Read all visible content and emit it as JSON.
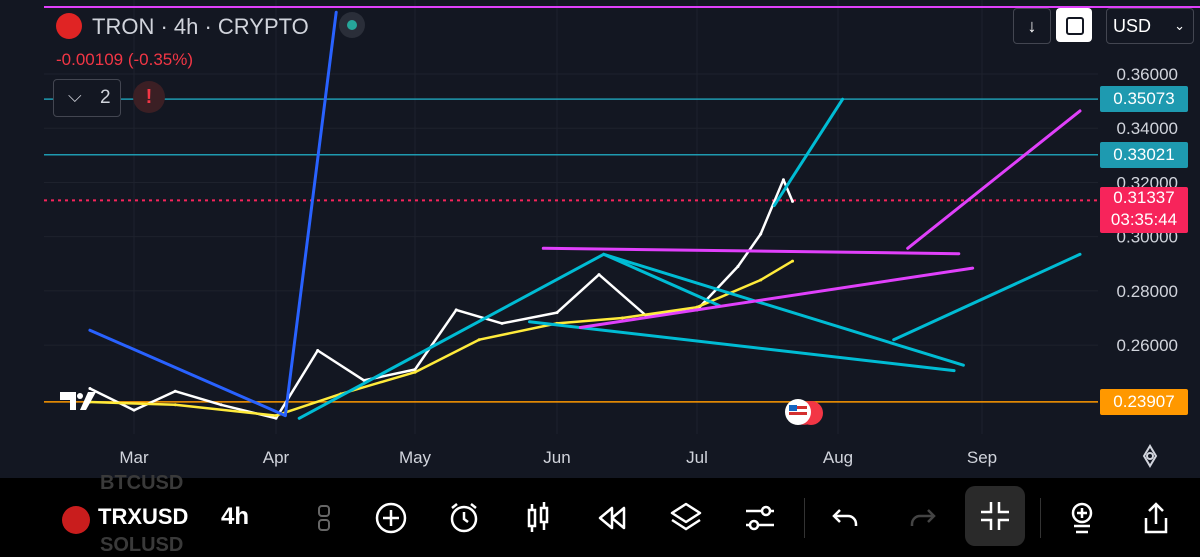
{
  "header": {
    "title": "TRON · 4h · CRYPTO",
    "change": "-0.00109 (-0.35%)",
    "indicator_count": "2",
    "alert_label": "!",
    "currency": "USD",
    "scroll_down_label": "↓"
  },
  "bottom_bar": {
    "symbol": "TRXUSD",
    "interval": "4h",
    "faded_above": "BTCUSD",
    "faded_below": "SOLUSD",
    "icons": [
      "layout-icon",
      "add-icon",
      "alarm-icon",
      "candles-icon",
      "replay-icon",
      "layers-icon",
      "settings-sliders-icon",
      "undo-icon",
      "redo-icon",
      "collapse-icon",
      "indicators-icon",
      "share-icon"
    ]
  },
  "chart_data": {
    "type": "line",
    "x_ticks": [
      "Mar",
      "Apr",
      "May",
      "Jun",
      "Jul",
      "Aug",
      "Sep"
    ],
    "y_ticks": [
      "0.36000",
      "0.34000",
      "0.32000",
      "0.30000",
      "0.28000",
      "0.26000"
    ],
    "ylim": [
      0.2316,
      0.3828
    ],
    "price_labels": [
      {
        "value": 0.35073,
        "label": "0.35073",
        "color": "#1e9ab0"
      },
      {
        "value": 0.33021,
        "label": "0.33021",
        "color": "#1e9ab0"
      },
      {
        "value": 0.31337,
        "label": "0.31337",
        "countdown": "03:35:44",
        "color": "#f7245b"
      },
      {
        "value": 0.23907,
        "label": "0.23907",
        "color": "#ff9800"
      }
    ],
    "series": [
      {
        "color": "#ffffff",
        "x": [
          "Feb 20",
          "Mar 1",
          "Mar 10",
          "Mar 20",
          "Apr 1",
          "Apr 10",
          "Apr 20",
          "May 1",
          "May 10",
          "May 20",
          "Jun 1",
          "Jun 10",
          "Jun 20",
          "Jul 1",
          "Jul 10",
          "Jul 15",
          "Jul 20",
          "Jul 22"
        ],
        "values": [
          0.244,
          0.236,
          0.243,
          0.238,
          0.233,
          0.258,
          0.247,
          0.251,
          0.273,
          0.268,
          0.272,
          0.286,
          0.271,
          0.273,
          0.289,
          0.301,
          0.321,
          0.313
        ]
      },
      {
        "color": "#ffeb3b",
        "x": [
          "Feb 20",
          "Mar 10",
          "Apr 1",
          "Apr 15",
          "May 1",
          "May 15",
          "Jun 1",
          "Jun 15",
          "Jul 1",
          "Jul 15",
          "Jul 22"
        ],
        "values": [
          0.239,
          0.238,
          0.234,
          0.242,
          0.25,
          0.262,
          0.268,
          0.27,
          0.274,
          0.284,
          0.291
        ]
      }
    ],
    "drawings": [
      {
        "color": "#2962ff",
        "points": [
          [
            "Feb 20",
            0.2655
          ],
          [
            "Apr 3",
            0.234
          ]
        ]
      },
      {
        "color": "#2962ff",
        "points": [
          [
            "Apr 3",
            0.234
          ],
          [
            "Apr 14",
            0.3828
          ]
        ]
      },
      {
        "color": "#00bcd4",
        "points": [
          [
            "Apr 6",
            0.233
          ],
          [
            "Jun 11",
            0.2935
          ],
          [
            "Jul 6",
            0.2745
          ]
        ]
      },
      {
        "color": "#00bcd4",
        "points": [
          [
            "May 26",
            0.2686
          ],
          [
            "Aug 26",
            0.2506
          ]
        ]
      },
      {
        "color": "#00bcd4",
        "points": [
          [
            "Jun 11",
            0.2935
          ],
          [
            "Aug 28",
            0.2526
          ]
        ]
      },
      {
        "color": "#00bcd4",
        "points": [
          [
            "Jul 18",
            0.3115
          ],
          [
            "Aug 2",
            0.3507
          ]
        ]
      },
      {
        "color": "#00bcd4",
        "points": [
          [
            "Aug 13",
            0.262
          ],
          [
            "Sep 22",
            0.2935
          ]
        ]
      },
      {
        "color": "#e040fb",
        "points": [
          [
            "May 29",
            0.2957
          ],
          [
            "Aug 27",
            0.2937
          ]
        ]
      },
      {
        "color": "#e040fb",
        "points": [
          [
            "Jun 6",
            0.2665
          ],
          [
            "Aug 30",
            0.2884
          ]
        ]
      },
      {
        "color": "#e040fb",
        "points": [
          [
            "Aug 16",
            0.2957
          ],
          [
            "Sep 22",
            0.3464
          ]
        ]
      }
    ]
  }
}
